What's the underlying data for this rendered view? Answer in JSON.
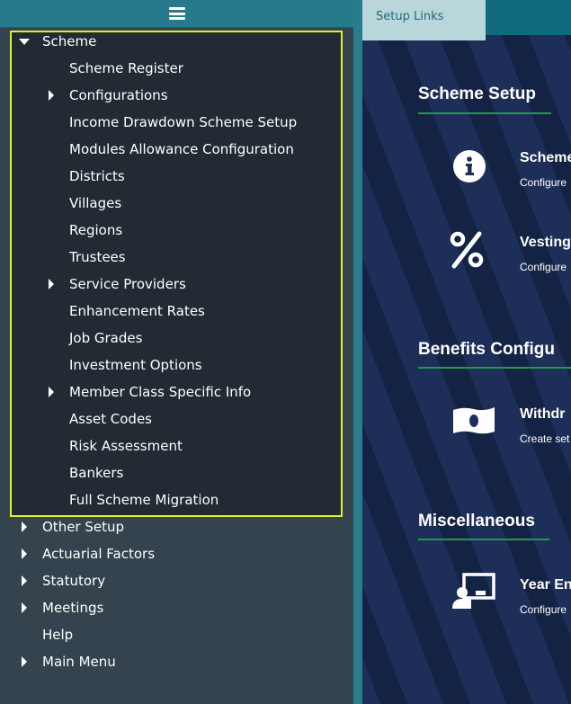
{
  "sidebar": {
    "menu_icon": "hamburger-menu-icon",
    "scheme": {
      "label": "Scheme",
      "children": [
        {
          "label": "Scheme Register",
          "has_submenu": false
        },
        {
          "label": "Configurations",
          "has_submenu": true
        },
        {
          "label": "Income Drawdown Scheme Setup",
          "has_submenu": false
        },
        {
          "label": "Modules Allowance Configuration",
          "has_submenu": false
        },
        {
          "label": "Districts",
          "has_submenu": false
        },
        {
          "label": "Villages",
          "has_submenu": false
        },
        {
          "label": "Regions",
          "has_submenu": false
        },
        {
          "label": "Trustees",
          "has_submenu": false
        },
        {
          "label": "Service Providers",
          "has_submenu": true
        },
        {
          "label": "Enhancement Rates",
          "has_submenu": false
        },
        {
          "label": "Job Grades",
          "has_submenu": false
        },
        {
          "label": "Investment Options",
          "has_submenu": false
        },
        {
          "label": "Member Class Specific Info",
          "has_submenu": true
        },
        {
          "label": "Asset Codes",
          "has_submenu": false
        },
        {
          "label": "Risk Assessment",
          "has_submenu": false
        },
        {
          "label": "Bankers",
          "has_submenu": false
        },
        {
          "label": "Full Scheme Migration",
          "has_submenu": false
        }
      ]
    },
    "top_items": [
      {
        "label": "Other Setup",
        "has_submenu": true
      },
      {
        "label": "Actuarial Factors",
        "has_submenu": true
      },
      {
        "label": "Statutory",
        "has_submenu": true
      },
      {
        "label": "Meetings",
        "has_submenu": true
      },
      {
        "label": "Help",
        "has_submenu": false
      },
      {
        "label": "Main Menu",
        "has_submenu": true
      }
    ]
  },
  "main": {
    "tab_label": "Setup Links",
    "sections": [
      {
        "title": "Scheme Setup",
        "items": [
          {
            "title": "Scheme",
            "description": "Configure",
            "icon": "info-circle-icon"
          },
          {
            "title": "Vesting",
            "description": "Configure",
            "icon": "percent-icon"
          }
        ]
      },
      {
        "title": "Benefits Configu",
        "items": [
          {
            "title": "Withdr",
            "description": "Create set",
            "icon": "money-bill-icon"
          }
        ]
      },
      {
        "title": "Miscellaneous",
        "items": [
          {
            "title": "Year En",
            "description": "Configure",
            "icon": "chalkboard-teacher-icon"
          }
        ]
      }
    ]
  },
  "colors": {
    "sidebar_bg": "#34434e",
    "scheme_box_bg": "#222a33",
    "highlight_border": "#dff22a",
    "header_teal": "#267a8c",
    "main_bg": "#1d2f58",
    "section_underline": "#1f9a4a",
    "tab_bg": "#b9d6da"
  }
}
